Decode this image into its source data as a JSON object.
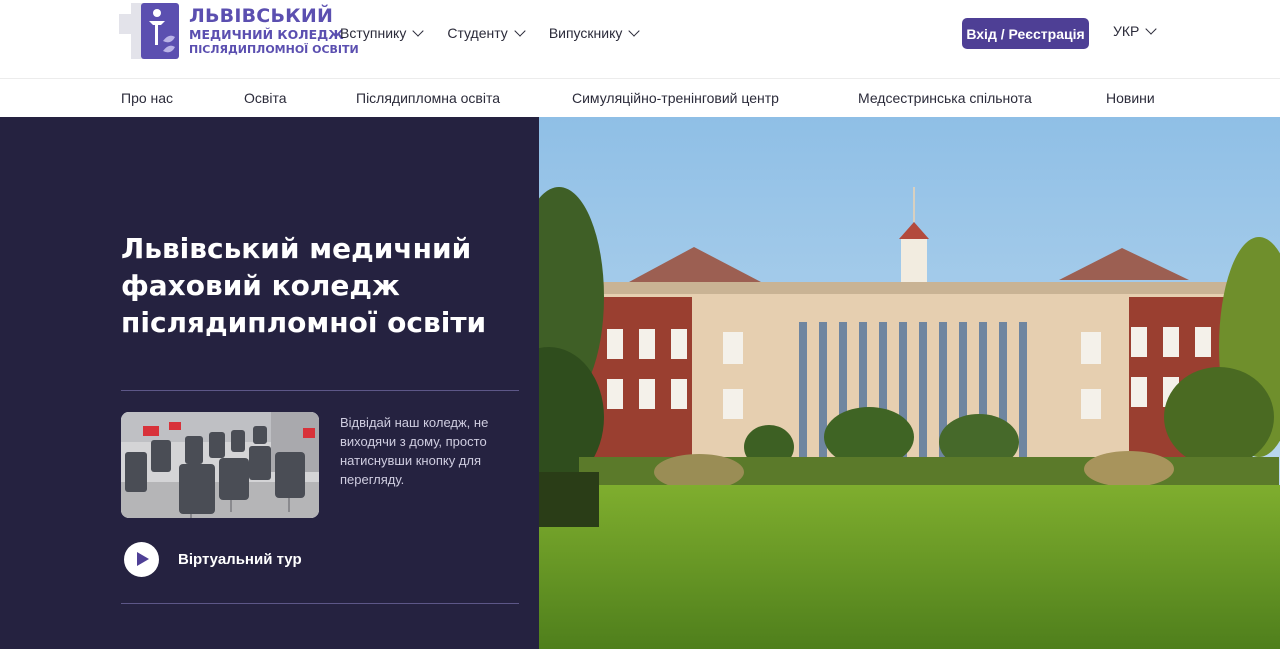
{
  "brand": {
    "line1": "ЛЬВІВСЬКИЙ",
    "line2": "МЕДИЧНИЙ КОЛЕДЖ",
    "line3": "ПІСЛЯДИПЛОМНОЇ ОСВІТИ",
    "accent": "#5b4fb0"
  },
  "header": {
    "nav": [
      {
        "label": "Вступнику"
      },
      {
        "label": "Студенту"
      },
      {
        "label": "Випускнику"
      }
    ],
    "login_label": "Вхід / Реєстрація",
    "lang_label": "УКР"
  },
  "subnav": [
    {
      "label": "Про нас"
    },
    {
      "label": "Освіта"
    },
    {
      "label": "Післядипломна освіта"
    },
    {
      "label": "Симуляційно-тренінговий центр"
    },
    {
      "label": "Медсестринська спільнота"
    },
    {
      "label": "Новини"
    }
  ],
  "hero": {
    "title": "Львівський медичний фаховий коледж післядипломної освіти",
    "tour_description": "Відвідай наш коледж, не виходячи з дому, просто натиснувши кнопку для перегляду.",
    "tour_label": "Віртуальний тур"
  },
  "colors": {
    "hero_bg": "#252240",
    "button": "#4e3f95"
  }
}
